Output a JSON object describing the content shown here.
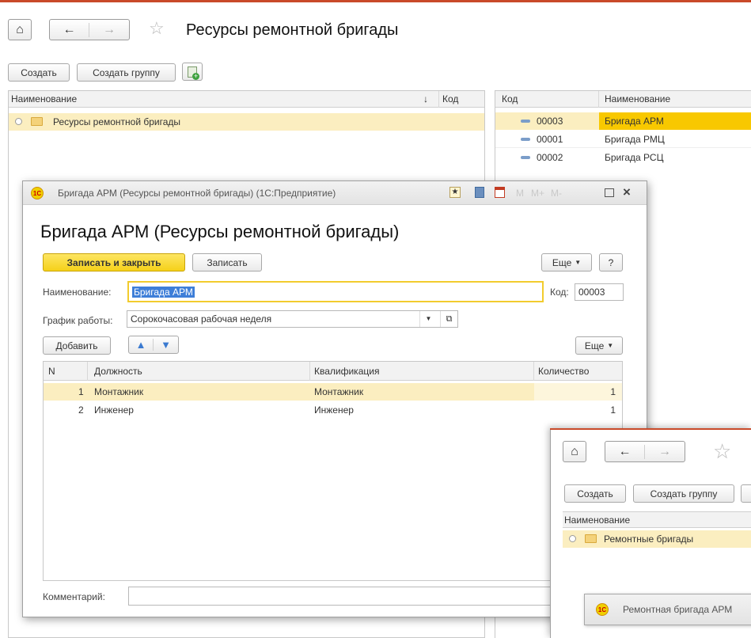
{
  "main": {
    "title": "Ресурсы ремонтной бригады",
    "create_label": "Создать",
    "create_group_label": "Создать группу",
    "left_list": {
      "col_name": "Наименование",
      "sort_arrow": "↓",
      "col_code": "Код",
      "rows": [
        {
          "name": "Ресурсы ремонтной бригады"
        }
      ]
    },
    "right_list": {
      "col_code": "Код",
      "col_name": "Наименование",
      "rows": [
        {
          "code": "00003",
          "name": "Бригада АРМ"
        },
        {
          "code": "00001",
          "name": "Бригада РМЦ"
        },
        {
          "code": "00002",
          "name": "Бригада РСЦ"
        }
      ]
    }
  },
  "form": {
    "window_title": "Бригада АРМ (Ресурсы ремонтной бригады)  (1С:Предприятие)",
    "heading": "Бригада АРМ (Ресурсы ремонтной бригады)",
    "save_close_label": "Записать и закрыть",
    "save_label": "Записать",
    "more_label": "Еще",
    "help_label": "?",
    "name_label": "Наименование:",
    "name_value": "Бригада АРМ",
    "code_label": "Код:",
    "code_value": "00003",
    "schedule_label": "График работы:",
    "schedule_value": "Сорокочасовая рабочая неделя",
    "add_label": "Добавить",
    "table_more_label": "Еще",
    "table": {
      "headers": [
        "N",
        "Должность",
        "Квалификация",
        "Количество"
      ],
      "rows": [
        {
          "n": "1",
          "position": "Монтажник",
          "qualification": "Монтажник",
          "qty": "1"
        },
        {
          "n": "2",
          "position": "Инженер",
          "qualification": "Инженер",
          "qty": "1"
        }
      ]
    },
    "comment_label": "Комментарий:",
    "comment_value": "",
    "m_labels": [
      "M",
      "M+",
      "M-"
    ]
  },
  "second": {
    "create_label": "Создать",
    "create_group_label": "Создать группу",
    "col_name": "Наименование",
    "row_name": "Ремонтные бригады",
    "sub_window_title": "Ремонтная бригада АРМ"
  },
  "colors": {
    "accent_yellow": "#f5d119",
    "selected_row": "#fbeec0",
    "highlight_cell": "#f8c800"
  }
}
